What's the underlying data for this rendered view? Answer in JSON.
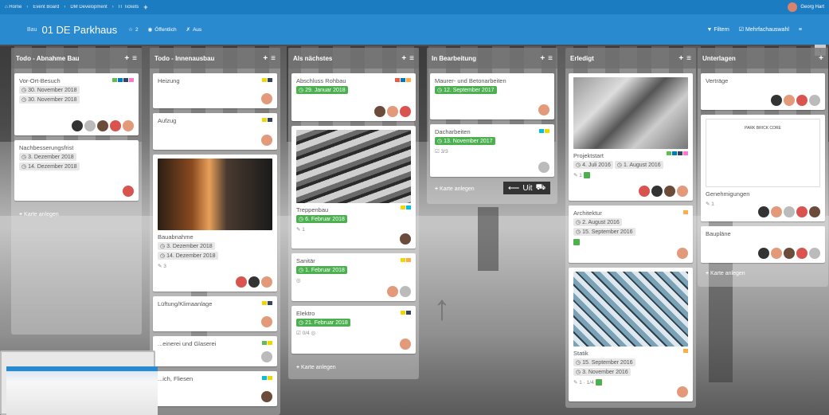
{
  "topnav": {
    "breadcrumbs": [
      "Home",
      "Event Board",
      "DM Development",
      "IT Tickets"
    ],
    "plus": "+",
    "user": "Georg Hart"
  },
  "board": {
    "prefix": "Bau",
    "title": "01 DE Parkhaus",
    "stars": "2",
    "visibility": "Öffentlich",
    "extra": "Aus",
    "filter_label": "Filtern",
    "multi_label": "Mehrfachauswahl",
    "menu_icon": "menu-icon"
  },
  "lists": [
    {
      "title": "Todo - Abnahme Bau",
      "cards": [
        {
          "title": "Vor-Ort-Besuch",
          "dates": [
            "30. November 2018",
            "30. November 2018"
          ]
        },
        {
          "title": "Nachbesserungsfrist",
          "dates": [
            "3. Dezember 2018",
            "14. Dezember 2018"
          ]
        }
      ],
      "add_label": "Karte anlegen"
    },
    {
      "title": "Todo - Innenausbau",
      "cards": [
        {
          "title": "Heizung"
        },
        {
          "title": "Aufzug"
        },
        {
          "title": "Bauabnahme",
          "dates": [
            "3. Dezember 2018",
            "14. Dezember 2018"
          ],
          "badge": "3"
        },
        {
          "title": "Lüftung/Klimaanlage"
        },
        {
          "title": "...einerei und Glaserei"
        },
        {
          "title": "...ich, Fliesen"
        }
      ]
    },
    {
      "title": "Als nächstes",
      "cards": [
        {
          "title": "Abschluss Rohbau",
          "date_green": "29. Januar 2018"
        },
        {
          "title": "Treppenbau",
          "date_green": "6. Februar 2018",
          "badge": "1"
        },
        {
          "title": "Sanitär",
          "date_green": "1. Februar 2018"
        },
        {
          "title": "Elektro",
          "date_green": "21. Februar 2018",
          "badge": "0/4"
        }
      ],
      "add_label": "Karte anlegen"
    },
    {
      "title": "In Bearbeitung",
      "cards": [
        {
          "title": "Maurer- und Betonarbeiten",
          "date_green": "12. September 2017"
        },
        {
          "title": "Dacharbeiten",
          "date_green": "13. November 2017",
          "badge": "3/3"
        }
      ],
      "add_label": "Karte anlegen",
      "overlay_label": "Uit"
    },
    {
      "title": "Erledigt",
      "cards": [
        {
          "title": "Projektstart",
          "dates": [
            "4. Juli 2016",
            "1. August 2016"
          ],
          "badge": "1"
        },
        {
          "title": "Architektur",
          "dates": [
            "2. August 2016",
            "15. September 2016"
          ]
        },
        {
          "title": "Statik",
          "dates": [
            "15. September 2016",
            "3. November 2016"
          ],
          "badge": "1 · 1/4"
        }
      ]
    },
    {
      "title": "Unterlagen",
      "cards": [
        {
          "title": "Verträge"
        },
        {
          "title": "Genehmigungen",
          "badge": "1",
          "doc_title": "PARK BRICK CORE"
        },
        {
          "title": "Baupläne"
        }
      ],
      "add_label": "Karte anlegen"
    }
  ],
  "colors": {
    "nav": "#1c7cc1",
    "board": "#2a8ad0",
    "green": "#4caf50",
    "label_green": "#61bd4f",
    "label_blue": "#0079bf",
    "label_pink": "#ff78cb",
    "label_yellow": "#f2d600",
    "label_orange": "#ffab4a",
    "label_dark": "#344563",
    "label_red": "#eb5a46",
    "label_teal": "#00c2e0"
  }
}
